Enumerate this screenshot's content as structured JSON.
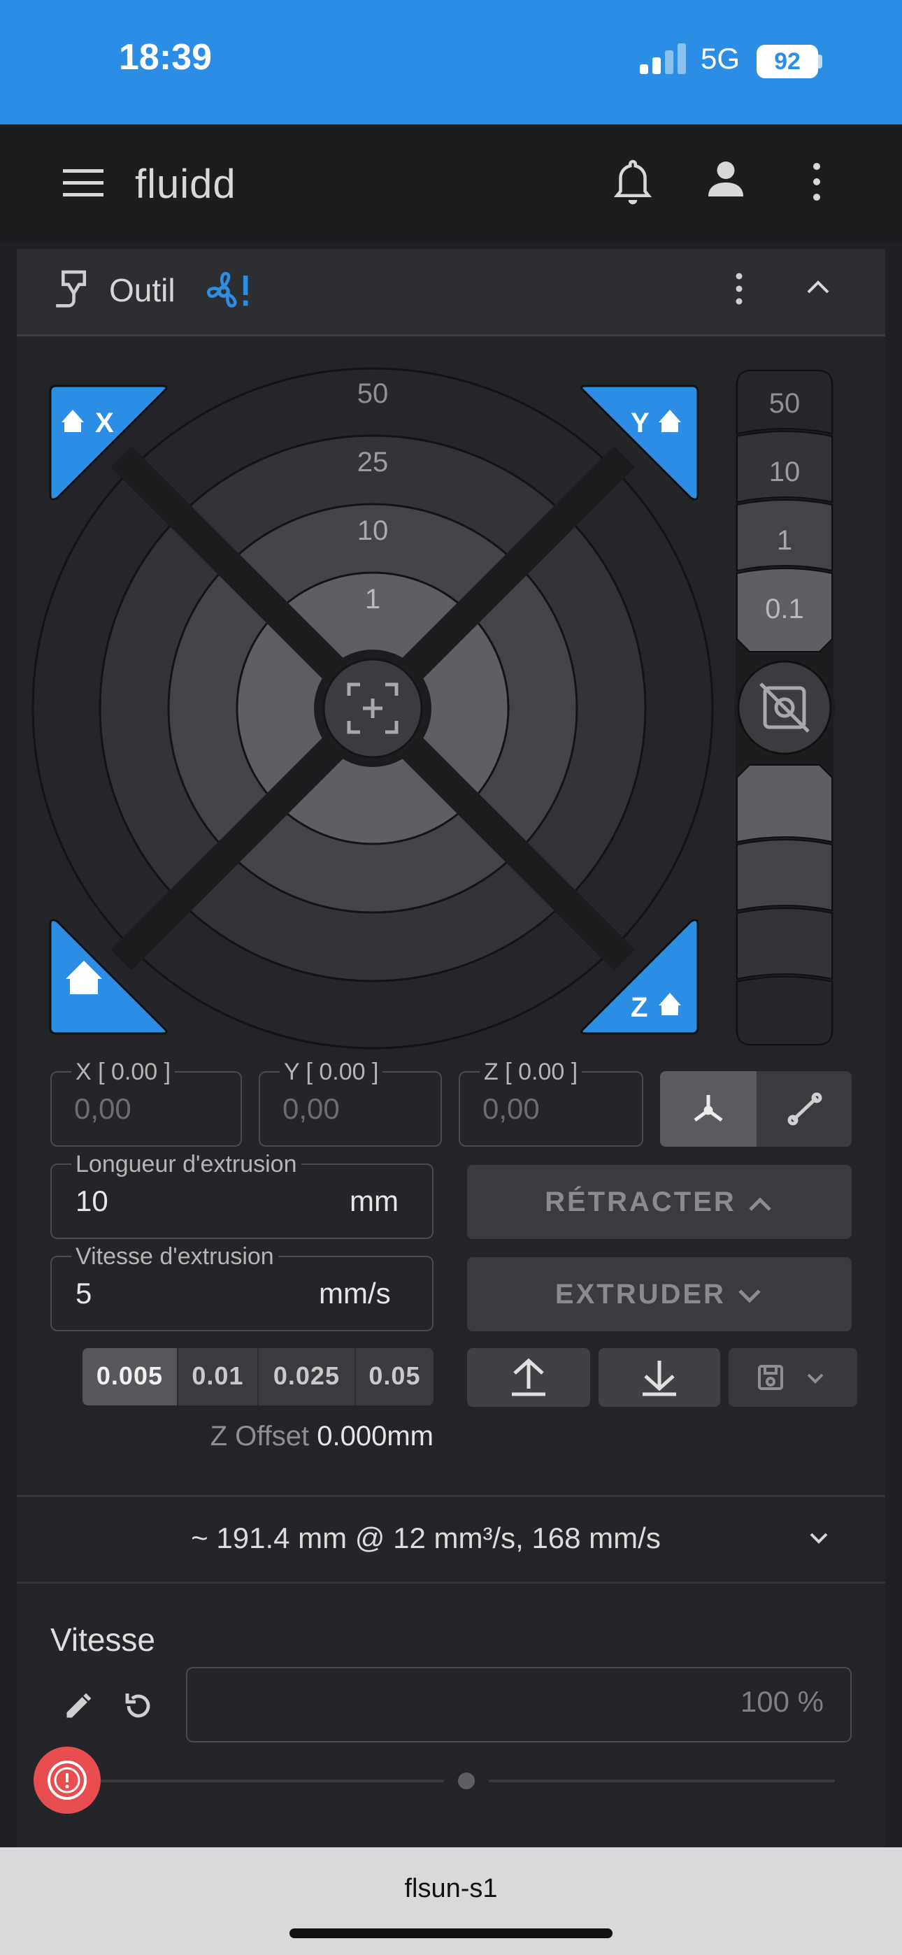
{
  "status_bar": {
    "time": "18:39",
    "network": "5G",
    "battery": "92"
  },
  "app_bar": {
    "title": "fluidd",
    "icons": [
      "menu-icon",
      "bell-icon",
      "account-icon",
      "kebab-icon"
    ]
  },
  "card": {
    "title": "Outil",
    "icons": [
      "tool-icon",
      "fan-icon",
      "kebab-icon",
      "chevron-up-icon"
    ]
  },
  "jog": {
    "home_x": "X",
    "home_y": "Y",
    "home_z": "Z",
    "xy_steps": [
      "50",
      "25",
      "10",
      "1"
    ],
    "z_steps": [
      "50",
      "10",
      "1",
      "0.1"
    ]
  },
  "position": {
    "x_label": "X [ 0.00 ]",
    "x_placeholder": "0,00",
    "y_label": "Y [ 0.00 ]",
    "y_placeholder": "0,00",
    "z_label": "Z [ 0.00 ]",
    "z_placeholder": "0,00"
  },
  "extrude": {
    "length_label": "Longueur d'extrusion",
    "length_value": "10",
    "length_unit": "mm",
    "speed_label": "Vitesse d'extrusion",
    "speed_value": "5",
    "speed_unit": "mm/s",
    "retract_label": "RÉTRACTER",
    "extrude_label": "EXTRUDER"
  },
  "zoffset": {
    "steps": [
      "0.005",
      "0.01",
      "0.025",
      "0.05"
    ],
    "active_step": "0.005",
    "label": "Z Offset",
    "value": "0.000mm"
  },
  "summary": "~ 191.4 mm @ 12 mm³/s, 168 mm/s",
  "speed": {
    "title": "Vitesse",
    "value": "100",
    "unit": "%",
    "slider_fraction": 0.5
  },
  "bottom": {
    "printer_name": "flsun-s1"
  },
  "colors": {
    "accent": "#2b8ee4",
    "emergency": "#e84e4f"
  }
}
